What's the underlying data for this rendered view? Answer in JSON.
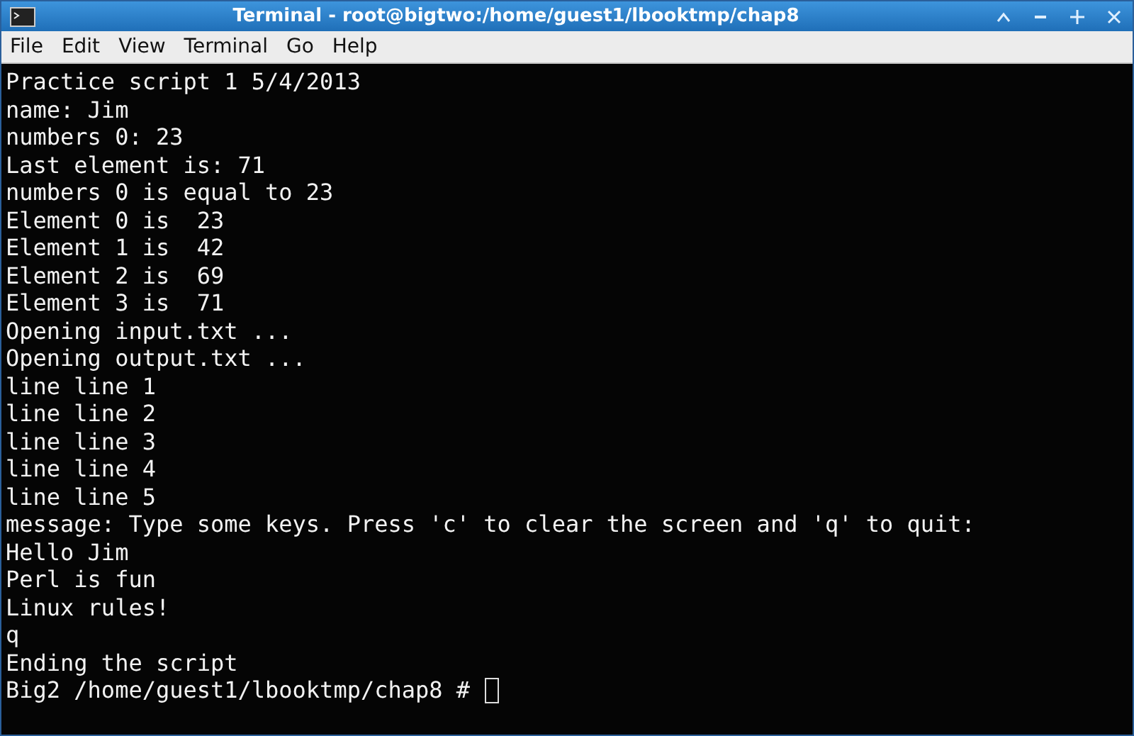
{
  "window": {
    "title": "Terminal - root@bigtwo:/home/guest1/lbooktmp/chap8"
  },
  "menu": [
    "File",
    "Edit",
    "View",
    "Terminal",
    "Go",
    "Help"
  ],
  "terminal": {
    "lines": [
      "Practice script 1 5/4/2013",
      "name: Jim",
      "numbers 0: 23",
      "Last element is: 71",
      "numbers 0 is equal to 23",
      "Element 0 is  23",
      "Element 1 is  42",
      "Element 2 is  69",
      "Element 3 is  71",
      "Opening input.txt ...",
      "Opening output.txt ...",
      "line line 1",
      "line line 2",
      "line line 3",
      "line line 4",
      "line line 5",
      "message: Type some keys. Press 'c' to clear the screen and 'q' to quit:",
      "Hello Jim",
      "Perl is fun",
      "Linux rules!",
      "q",
      "Ending the script"
    ],
    "prompt": "Big2 /home/guest1/lbooktmp/chap8 #"
  }
}
